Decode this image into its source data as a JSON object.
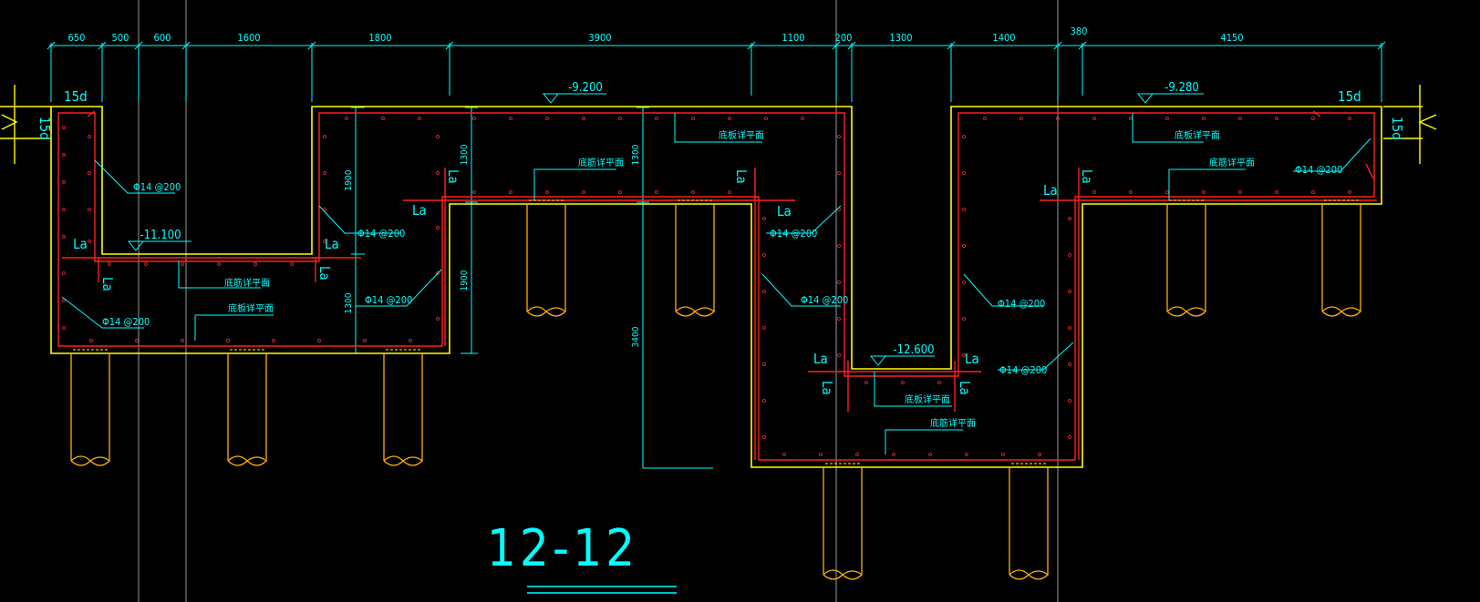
{
  "title": "12-12",
  "colors": {
    "background": "#000000",
    "dimension": "#00ffff",
    "outline": "#ffff00",
    "rebar": "#ff2020",
    "pile": "#ffb000",
    "gridline": "#9a9a9a"
  },
  "dimensions": [
    "650",
    "500",
    "600",
    "1600",
    "1800",
    "3900",
    "1100",
    "200",
    "1300",
    "1400",
    "380",
    "4150"
  ],
  "vertical_dims": {
    "left_1900": "1900",
    "left_1300": "1300",
    "mid_1300": "1300",
    "mid_1900": "1900",
    "center_1300": "1300",
    "center_3400": "3400"
  },
  "elevations": {
    "left": "-11.100",
    "top_center": "-9.200",
    "top_right": "-9.280",
    "bottom_pit": "-12.600"
  },
  "rebar_labels": {
    "phi14_200": "Φ14 @200",
    "la": "La",
    "fifteen_d": "15d",
    "floor_top_note": "底筋详平面",
    "floor_bottom_note": "底板详平面"
  },
  "icons": {
    "break_line": "break-line-icon",
    "elevation_marker": "elevation-triangle-icon",
    "pile": "pile-icon"
  }
}
